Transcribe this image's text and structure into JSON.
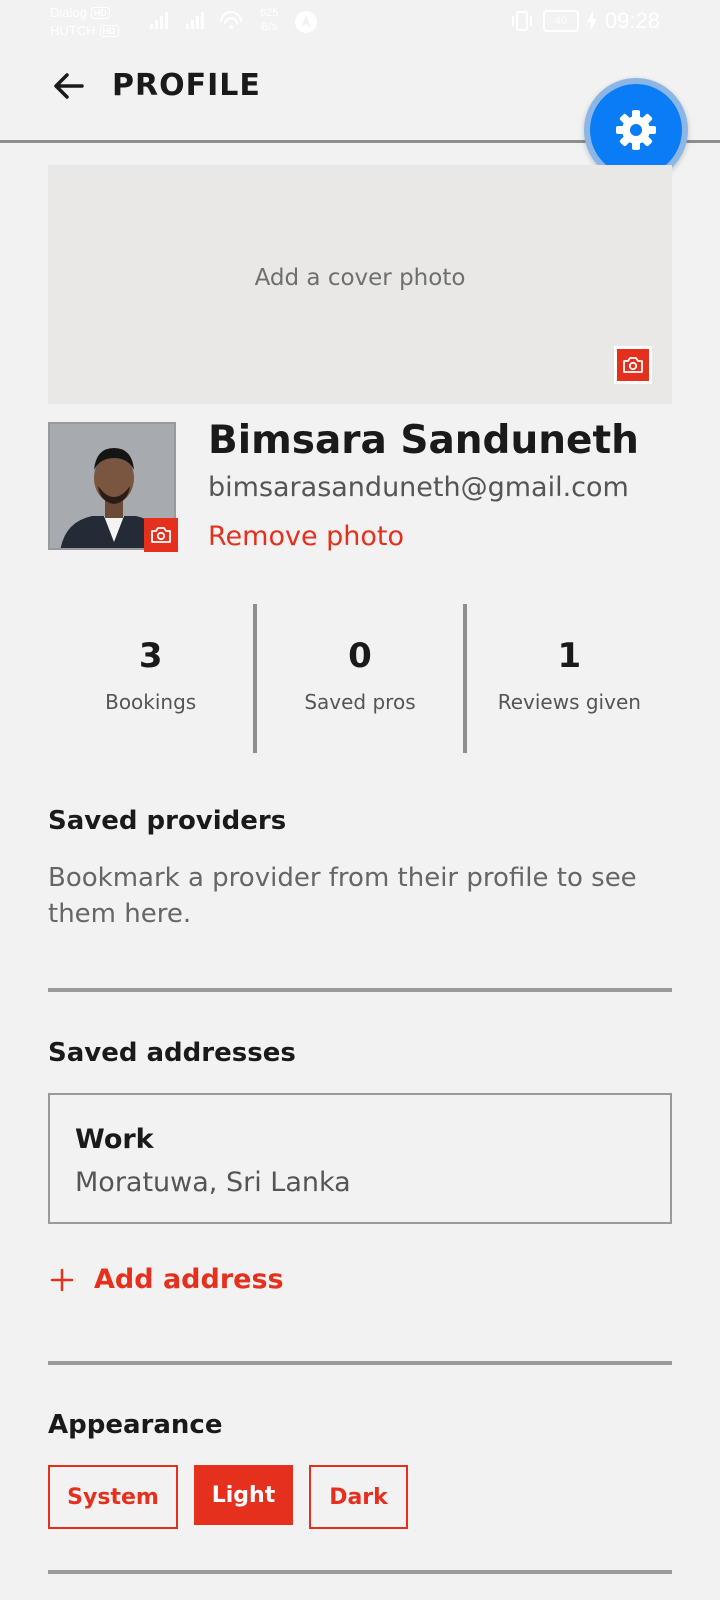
{
  "status_bar": {
    "carrier1": "Dialog",
    "carrier2": "HUTCH",
    "tag": "HD",
    "net_speed_value": "625",
    "net_speed_unit": "B/s",
    "battery": "40",
    "time": "09:28"
  },
  "header": {
    "title": "PROFILE"
  },
  "cover": {
    "placeholder": "Add a cover photo"
  },
  "profile": {
    "name": "Bimsara Sanduneth",
    "email": "bimsarasanduneth@gmail.com",
    "remove_photo": "Remove photo"
  },
  "stats": [
    {
      "value": "3",
      "label": "Bookings"
    },
    {
      "value": "0",
      "label": "Saved pros"
    },
    {
      "value": "1",
      "label": "Reviews given"
    }
  ],
  "saved_providers": {
    "title": "Saved providers",
    "empty_text": "Bookmark a provider from their profile to see them here."
  },
  "saved_addresses": {
    "title": "Saved addresses",
    "items": [
      {
        "label": "Work",
        "address": "Moratuwa, Sri Lanka"
      }
    ],
    "add_label": "Add address"
  },
  "appearance": {
    "title": "Appearance",
    "options": [
      "System",
      "Light",
      "Dark"
    ],
    "selected": "Light"
  },
  "colors": {
    "accent": "#e5301e",
    "fab": "#0a7cf5",
    "background": "#f2f2f2"
  }
}
